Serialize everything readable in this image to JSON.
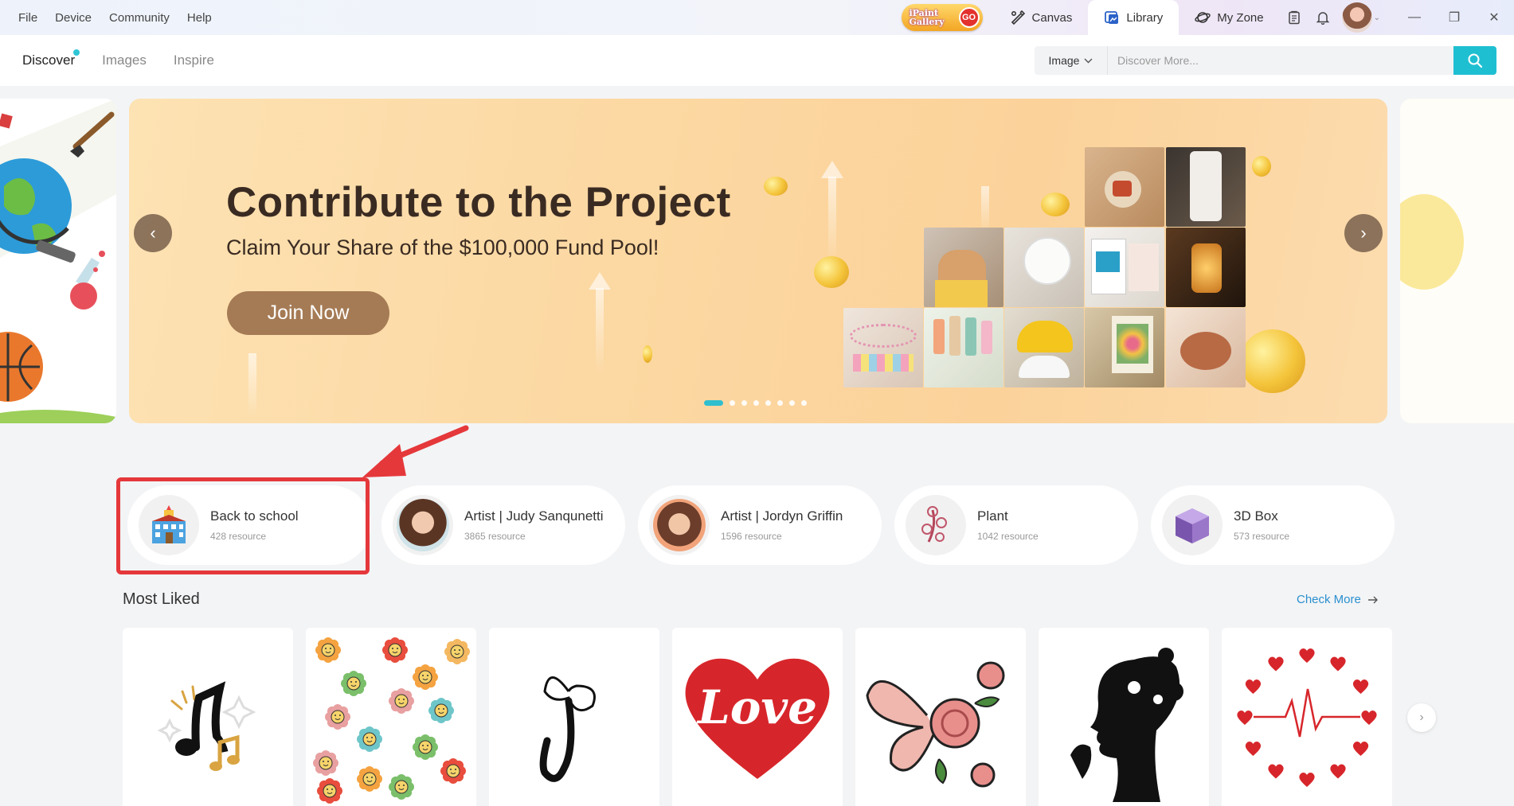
{
  "menu": [
    "File",
    "Device",
    "Community",
    "Help"
  ],
  "gallery_badge": {
    "line1": "iPaint",
    "line2": "Gallery",
    "go": "GO"
  },
  "nav": {
    "canvas": "Canvas",
    "library": "Library",
    "myzone": "My Zone"
  },
  "subnav": {
    "tabs": [
      "Discover",
      "Images",
      "Inspire"
    ],
    "active": "Discover"
  },
  "search": {
    "type": "Image",
    "placeholder": "Discover More..."
  },
  "banner": {
    "title": "Contribute to the Project",
    "subtitle": "Claim Your Share of the $100,000 Fund Pool!",
    "cta": "Join Now",
    "slide_count": 8,
    "active_slide": 1
  },
  "categories": [
    {
      "name": "Back to school",
      "count": "428 resource",
      "icon": "school-building-icon",
      "highlighted": true
    },
    {
      "name": "Artist | Judy Sanqunetti",
      "count": "3865 resource",
      "icon": "artist-avatar"
    },
    {
      "name": "Artist | Jordyn Griffin",
      "count": "1596 resource",
      "icon": "artist-avatar"
    },
    {
      "name": "Plant",
      "count": "1042 resource",
      "icon": "floral-icon"
    },
    {
      "name": "3D Box",
      "count": "573 resource",
      "icon": "cube-box-icon"
    }
  ],
  "section": {
    "title": "Most Liked",
    "check_more": "Check More"
  },
  "cards": [
    "music-notes",
    "smiley-flowers",
    "butterfly-letter-j",
    "love-heart",
    "butterfly-roses",
    "floral-silhouette",
    "heartbeat-hearts"
  ],
  "colors": {
    "accent": "#1fbfd2",
    "highlight": "#e5383b",
    "join": "#a57b55",
    "link": "#2a8fcf"
  }
}
